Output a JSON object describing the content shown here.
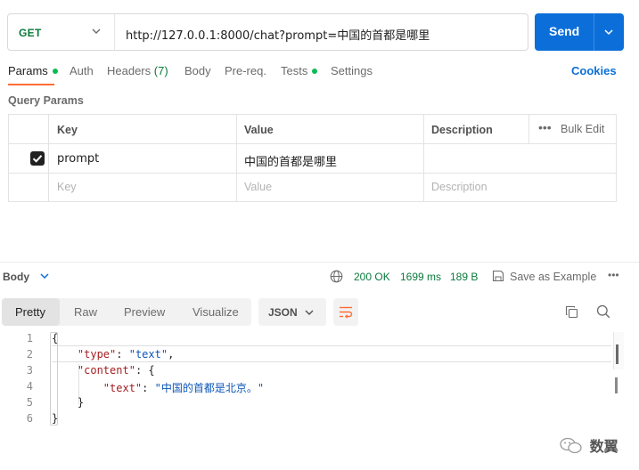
{
  "request": {
    "method": "GET",
    "url": "http://127.0.0.1:8000/chat?prompt=中国的首都是哪里",
    "send_label": "Send"
  },
  "tabs": [
    {
      "label": "Params",
      "dot": true
    },
    {
      "label": "Auth"
    },
    {
      "label": "Headers",
      "count": "(7)"
    },
    {
      "label": "Body"
    },
    {
      "label": "Pre-req."
    },
    {
      "label": "Tests",
      "dot": true
    },
    {
      "label": "Settings"
    }
  ],
  "cookies_label": "Cookies",
  "query_params": {
    "title": "Query Params",
    "headers": {
      "key": "Key",
      "value": "Value",
      "description": "Description",
      "bulk_edit": "Bulk Edit"
    },
    "rows": [
      {
        "checked": true,
        "key": "prompt",
        "value": "中国的首都是哪里",
        "description": ""
      }
    ],
    "placeholders": {
      "key": "Key",
      "value": "Value",
      "description": "Description"
    }
  },
  "response": {
    "body_label": "Body",
    "status": "200 OK",
    "time": "1699 ms",
    "size": "189 B",
    "save_label": "Save as Example",
    "view_tabs": [
      "Pretty",
      "Raw",
      "Preview",
      "Visualize"
    ],
    "active_view": "Pretty",
    "format": "JSON",
    "line_numbers": [
      "1",
      "2",
      "3",
      "4",
      "5",
      "6"
    ],
    "code": {
      "type_key": "\"type\"",
      "type_value": "\"text\"",
      "content_key": "\"content\"",
      "text_key": "\"text\"",
      "text_value": "\"中国的首都是北京。\""
    }
  },
  "watermark": "数翼",
  "colors": {
    "send": "#0c6fd9",
    "method": "#0a7a3c",
    "active_tab_underline": "#ff6c37",
    "dot": "#0cbb52"
  }
}
